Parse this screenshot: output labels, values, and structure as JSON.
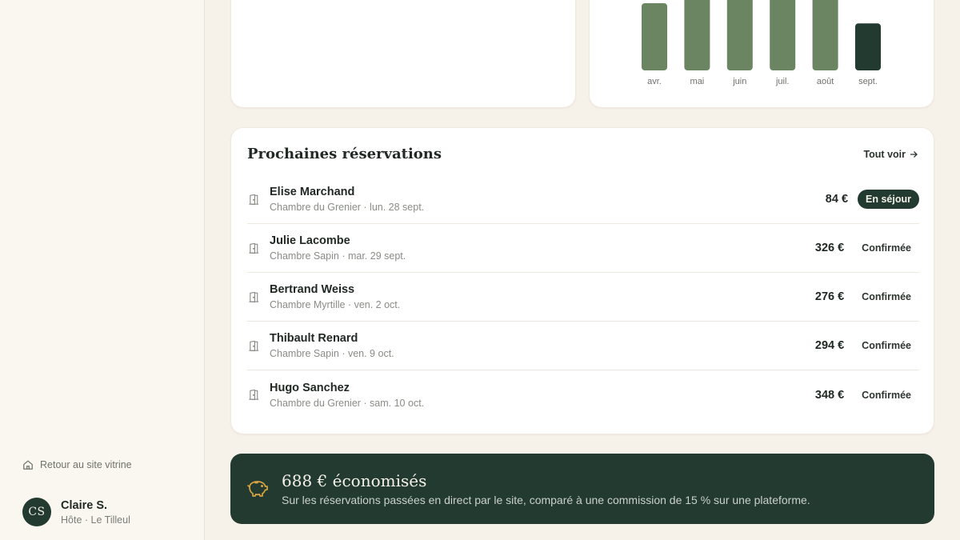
{
  "sidebar": {
    "back_link": "Retour au site vitrine",
    "user": {
      "initials": "CS",
      "name": "Claire S.",
      "role": "Hôte · Le Tilleul"
    }
  },
  "chart_data": {
    "type": "bar",
    "categories": [
      "avr.",
      "mai",
      "juin",
      "juil.",
      "août",
      "sept."
    ],
    "values": [
      60,
      85,
      100,
      100,
      100,
      42
    ],
    "highlight_index": 5,
    "bar_color": "#6b8462",
    "highlight_color": "#223a30",
    "ylim": [
      0,
      100
    ]
  },
  "reservations": {
    "title": "Prochaines réservations",
    "see_all": "Tout voir",
    "rows": [
      {
        "name": "Elise Marchand",
        "sub": "Chambre du Grenier · lun. 28 sept.",
        "price": "84 €",
        "status": "En séjour",
        "active": true
      },
      {
        "name": "Julie Lacombe",
        "sub": "Chambre Sapin · mar. 29 sept.",
        "price": "326 €",
        "status": "Confirmée",
        "active": false
      },
      {
        "name": "Bertrand Weiss",
        "sub": "Chambre Myrtille · ven. 2 oct.",
        "price": "276 €",
        "status": "Confirmée",
        "active": false
      },
      {
        "name": "Thibault Renard",
        "sub": "Chambre Sapin · ven. 9 oct.",
        "price": "294 €",
        "status": "Confirmée",
        "active": false
      },
      {
        "name": "Hugo Sanchez",
        "sub": "Chambre du Grenier · sam. 10 oct.",
        "price": "348 €",
        "status": "Confirmée",
        "active": false
      }
    ]
  },
  "savings": {
    "title": "688 € économisés",
    "text": "Sur les réservations passées en direct par le site, comparé à une commission de 15 % sur une plateforme.",
    "icon_color": "#d9a441"
  },
  "colors": {
    "accent_dark": "#223a30",
    "background": "#f6f2ea"
  }
}
